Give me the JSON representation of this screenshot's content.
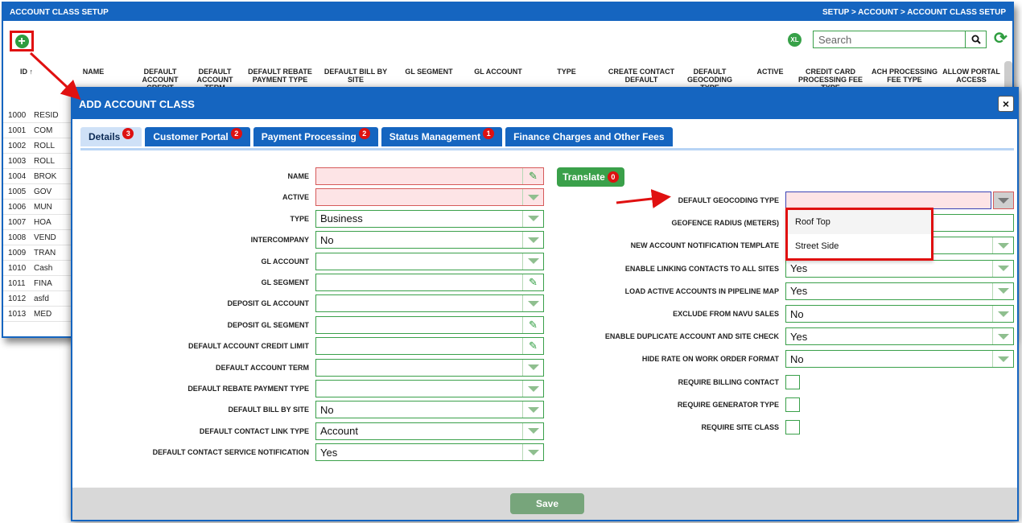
{
  "bg": {
    "title": "ACCOUNT CLASS SETUP",
    "breadcrumb": "SETUP > ACCOUNT > ACCOUNT CLASS SETUP",
    "search_placeholder": "Search",
    "excel_label": "XL",
    "columns": {
      "id": "ID ↑",
      "name": "NAME",
      "credit": "DEFAULT ACCOUNT CREDIT",
      "term": "DEFAULT ACCOUNT TERM",
      "rebate": "DEFAULT REBATE PAYMENT TYPE",
      "billsite": "DEFAULT BILL BY SITE",
      "glseg": "GL SEGMENT",
      "glacct": "GL ACCOUNT",
      "type": "TYPE",
      "contact": "CREATE CONTACT DEFAULT",
      "geocode": "DEFAULT GEOCODING TYPE",
      "active": "ACTIVE",
      "ccfee": "CREDIT CARD PROCESSING FEE TYPE",
      "achfee": "ACH PROCESSING FEE TYPE",
      "portal": "ALLOW PORTAL ACCESS"
    },
    "rows": [
      {
        "id": "1000",
        "name": "RESID"
      },
      {
        "id": "1001",
        "name": "COM"
      },
      {
        "id": "1002",
        "name": "ROLL"
      },
      {
        "id": "1003",
        "name": "ROLL"
      },
      {
        "id": "1004",
        "name": "BROK"
      },
      {
        "id": "1005",
        "name": "GOV"
      },
      {
        "id": "1006",
        "name": "MUN"
      },
      {
        "id": "1007",
        "name": "HOA"
      },
      {
        "id": "1008",
        "name": "VEND"
      },
      {
        "id": "1009",
        "name": "TRAN"
      },
      {
        "id": "1010",
        "name": "Cash"
      },
      {
        "id": "1011",
        "name": "FINA"
      },
      {
        "id": "1012",
        "name": "asfd"
      },
      {
        "id": "1013",
        "name": "MED"
      }
    ]
  },
  "modal": {
    "title": "ADD ACCOUNT CLASS",
    "close": "×",
    "tabs": [
      {
        "label": "Details",
        "badge": "3"
      },
      {
        "label": "Customer Portal",
        "badge": "2"
      },
      {
        "label": "Payment Processing",
        "badge": "2"
      },
      {
        "label": "Status Management",
        "badge": "1"
      },
      {
        "label": "Finance Charges and Other Fees",
        "badge": ""
      }
    ],
    "translate": {
      "label": "Translate",
      "badge": "0"
    },
    "left_fields": [
      {
        "label": "NAME",
        "value": "",
        "kind": "text",
        "req": true
      },
      {
        "label": "ACTIVE",
        "value": "",
        "kind": "select",
        "req": true
      },
      {
        "label": "TYPE",
        "value": "Business",
        "kind": "select",
        "req": false
      },
      {
        "label": "INTERCOMPANY",
        "value": "No",
        "kind": "select",
        "req": false
      },
      {
        "label": "GL ACCOUNT",
        "value": "",
        "kind": "select",
        "req": false
      },
      {
        "label": "GL SEGMENT",
        "value": "",
        "kind": "text",
        "req": false
      },
      {
        "label": "DEPOSIT GL ACCOUNT",
        "value": "",
        "kind": "select",
        "req": false
      },
      {
        "label": "DEPOSIT GL SEGMENT",
        "value": "",
        "kind": "text",
        "req": false
      },
      {
        "label": "DEFAULT ACCOUNT CREDIT LIMIT",
        "value": "",
        "kind": "text",
        "req": false
      },
      {
        "label": "DEFAULT ACCOUNT TERM",
        "value": "",
        "kind": "select",
        "req": false
      },
      {
        "label": "DEFAULT REBATE PAYMENT TYPE",
        "value": "",
        "kind": "select",
        "req": false
      },
      {
        "label": "DEFAULT BILL BY SITE",
        "value": "No",
        "kind": "select",
        "req": false
      },
      {
        "label": "DEFAULT CONTACT LINK TYPE",
        "value": "Account",
        "kind": "select",
        "req": false
      },
      {
        "label": "DEFAULT CONTACT SERVICE NOTIFICATION",
        "value": "Yes",
        "kind": "select",
        "req": false
      }
    ],
    "right_fields": [
      {
        "label": "DEFAULT GEOCODING TYPE",
        "value": "",
        "kind": "geo"
      },
      {
        "label": "GEOFENCE RADIUS (METERS)",
        "value": "",
        "kind": "plain"
      },
      {
        "label": "NEW ACCOUNT NOTIFICATION TEMPLATE",
        "value": "",
        "kind": "select"
      },
      {
        "label": "ENABLE LINKING CONTACTS TO ALL SITES",
        "value": "Yes",
        "kind": "select"
      },
      {
        "label": "LOAD ACTIVE ACCOUNTS IN PIPELINE MAP",
        "value": "Yes",
        "kind": "select"
      },
      {
        "label": "EXCLUDE FROM NAVU SALES",
        "value": "No",
        "kind": "select"
      },
      {
        "label": "ENABLE DUPLICATE ACCOUNT AND SITE CHECK",
        "value": "Yes",
        "kind": "select"
      },
      {
        "label": "HIDE RATE ON WORK ORDER FORMAT",
        "value": "No",
        "kind": "select"
      },
      {
        "label": "REQUIRE BILLING CONTACT",
        "value": "",
        "kind": "check"
      },
      {
        "label": "REQUIRE GENERATOR TYPE",
        "value": "",
        "kind": "check"
      },
      {
        "label": "REQUIRE SITE CLASS",
        "value": "",
        "kind": "check"
      }
    ],
    "geo_options": [
      "Roof Top",
      "Street Side"
    ],
    "save": "Save"
  },
  "colors": {
    "primary": "#1565c0",
    "green": "#3aa04a",
    "highlight_red": "#e01010",
    "required_bg": "#fde4e6"
  }
}
